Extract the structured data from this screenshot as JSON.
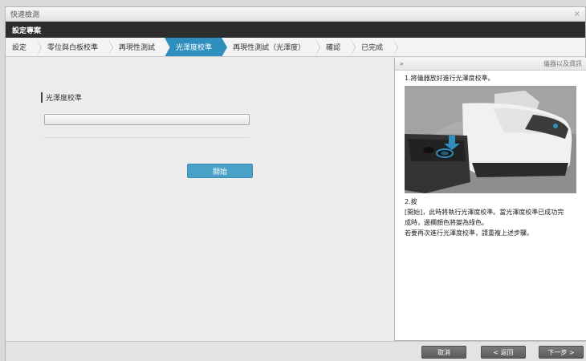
{
  "window": {
    "title": "快速檢測",
    "close_glyph": "×"
  },
  "header": {
    "title": "設定專案"
  },
  "steps": [
    {
      "label": "設定"
    },
    {
      "label": "零位與白板校準"
    },
    {
      "label": "再現性測試"
    },
    {
      "label": "光澤度校準"
    },
    {
      "label": "再現性測試（光澤度）"
    },
    {
      "label": "確認"
    },
    {
      "label": "已完成"
    }
  ],
  "active_step": "光澤度校準",
  "main": {
    "section_label": "光澤度校準",
    "progress_value": 0,
    "start_label": "開始"
  },
  "panel": {
    "collapse_glyph": "»",
    "title": "儀器以及資訊",
    "step1": "1.將儀器放好進行光澤度校準。",
    "step2_title": "2.按",
    "step2_lines": [
      "[開始]，此時將執行光澤度校準。當光澤度校準已成功完",
      "成時，邊欄顏色將變為綠色。",
      "若要再次進行光澤度校準，請重複上述步驟。"
    ]
  },
  "footer": {
    "cancel_label": "取消",
    "back_label": "< 返回",
    "next_label": "下一步 >"
  },
  "colors": {
    "accent": "#2e8fbd",
    "button_blue": "#4aa1c8",
    "header_dark": "#2d2d2d"
  }
}
